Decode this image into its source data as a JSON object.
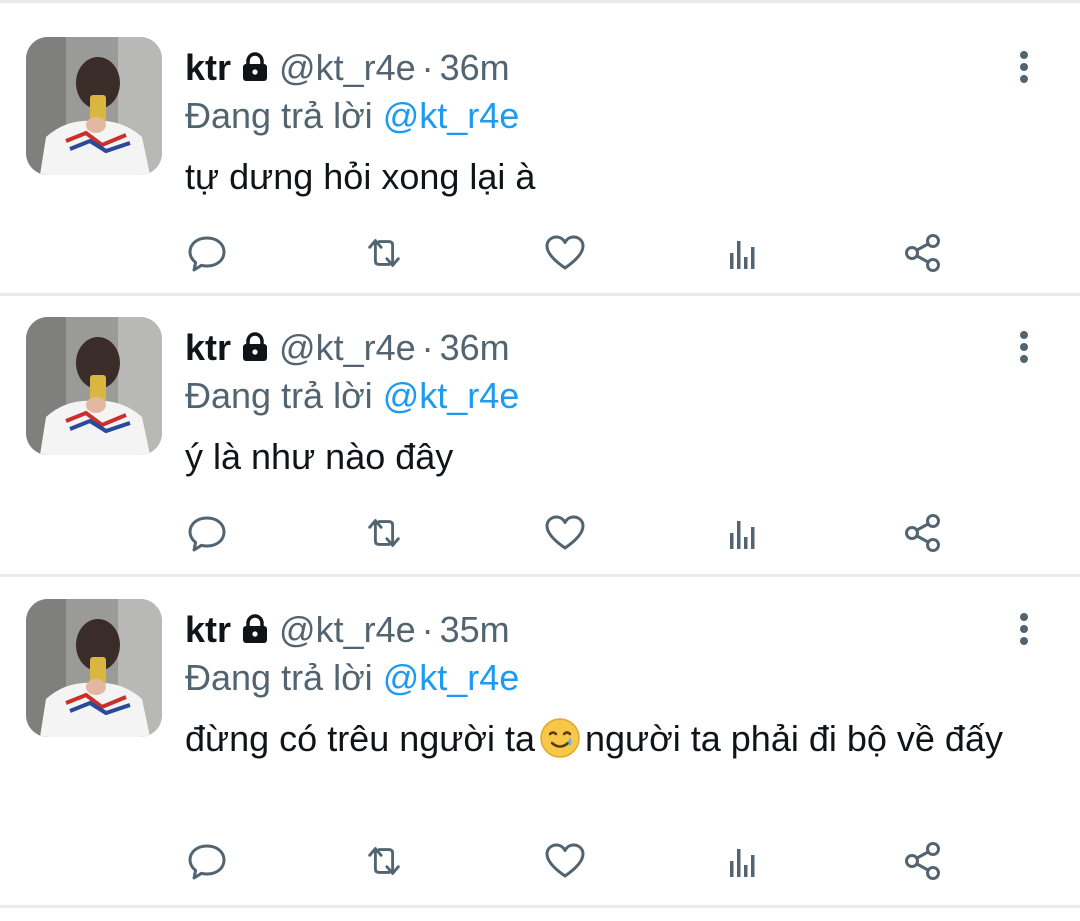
{
  "tweets": [
    {
      "name": "ktr",
      "handle": "@kt_r4e",
      "separator": "·",
      "time": "36m",
      "replying_prefix": "Đang trả lời",
      "replying_to": "@kt_r4e",
      "text": "tự dưng hỏi xong lại à",
      "text_after_emoji": ""
    },
    {
      "name": "ktr",
      "handle": "@kt_r4e",
      "separator": "·",
      "time": "36m",
      "replying_prefix": "Đang trả lời",
      "replying_to": "@kt_r4e",
      "text": "ý là như nào đây",
      "text_after_emoji": ""
    },
    {
      "name": "ktr",
      "handle": "@kt_r4e",
      "separator": "·",
      "time": "35m",
      "replying_prefix": "Đang trả lời",
      "replying_to": "@kt_r4e",
      "text": "đừng có trêu người ta",
      "emoji": "smiling-face-with-tear",
      "text_after_emoji": "người ta phải đi bộ về đấy"
    }
  ],
  "actions": [
    "reply-icon",
    "retweet-icon",
    "like-icon",
    "analytics-icon",
    "share-icon"
  ],
  "colors": {
    "text": "#0f1419",
    "secondary": "#536471",
    "mention": "#1d9bf0",
    "divider": "#e8ecef"
  }
}
